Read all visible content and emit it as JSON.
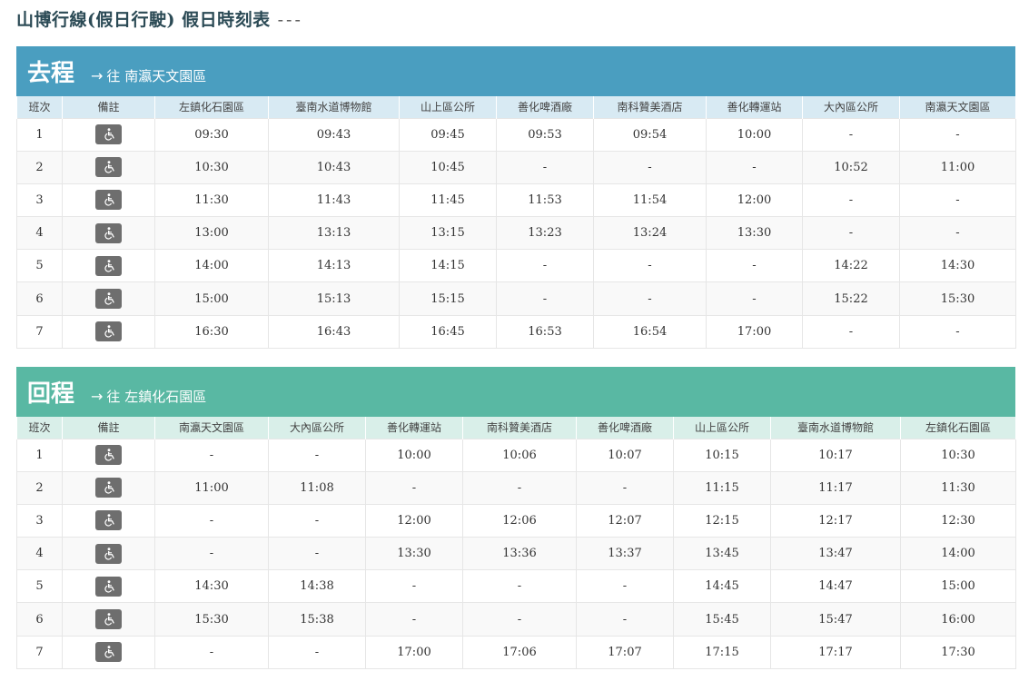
{
  "page": {
    "title": "山博行線(假日行駛) 假日時刻表",
    "dashes": "---"
  },
  "outbound": {
    "title": "去程",
    "arrow": "→",
    "dest": "往 南瀛天文園區",
    "headers": [
      "班次",
      "備註",
      "左鎮化石園區",
      "臺南水道博物館",
      "山上區公所",
      "善化啤酒廠",
      "南科贊美酒店",
      "善化轉運站",
      "大內區公所",
      "南瀛天文園區"
    ],
    "rows": [
      [
        "1",
        "09:30",
        "09:43",
        "09:45",
        "09:53",
        "09:54",
        "10:00",
        "-",
        "-"
      ],
      [
        "2",
        "10:30",
        "10:43",
        "10:45",
        "-",
        "-",
        "-",
        "10:52",
        "11:00"
      ],
      [
        "3",
        "11:30",
        "11:43",
        "11:45",
        "11:53",
        "11:54",
        "12:00",
        "-",
        "-"
      ],
      [
        "4",
        "13:00",
        "13:13",
        "13:15",
        "13:23",
        "13:24",
        "13:30",
        "-",
        "-"
      ],
      [
        "5",
        "14:00",
        "14:13",
        "14:15",
        "-",
        "-",
        "-",
        "14:22",
        "14:30"
      ],
      [
        "6",
        "15:00",
        "15:13",
        "15:15",
        "-",
        "-",
        "-",
        "15:22",
        "15:30"
      ],
      [
        "7",
        "16:30",
        "16:43",
        "16:45",
        "16:53",
        "16:54",
        "17:00",
        "-",
        "-"
      ]
    ]
  },
  "return": {
    "title": "回程",
    "arrow": "→",
    "dest": "往 左鎮化石園區",
    "headers": [
      "班次",
      "備註",
      "南瀛天文園區",
      "大內區公所",
      "善化轉運站",
      "南科贊美酒店",
      "善化啤酒廠",
      "山上區公所",
      "臺南水道博物館",
      "左鎮化石園區"
    ],
    "rows": [
      [
        "1",
        "-",
        "-",
        "10:00",
        "10:06",
        "10:07",
        "10:15",
        "10:17",
        "10:30"
      ],
      [
        "2",
        "11:00",
        "11:08",
        "-",
        "-",
        "-",
        "11:15",
        "11:17",
        "11:30"
      ],
      [
        "3",
        "-",
        "-",
        "12:00",
        "12:06",
        "12:07",
        "12:15",
        "12:17",
        "12:30"
      ],
      [
        "4",
        "-",
        "-",
        "13:30",
        "13:36",
        "13:37",
        "13:45",
        "13:47",
        "14:00"
      ],
      [
        "5",
        "14:30",
        "14:38",
        "-",
        "-",
        "-",
        "14:45",
        "14:47",
        "15:00"
      ],
      [
        "6",
        "15:30",
        "15:38",
        "-",
        "-",
        "-",
        "15:45",
        "15:47",
        "16:00"
      ],
      [
        "7",
        "-",
        "-",
        "17:00",
        "17:06",
        "17:07",
        "17:15",
        "17:17",
        "17:30"
      ]
    ]
  },
  "icons": {
    "note_icon": "wheelchair-accessible-icon"
  },
  "colors": {
    "outbound_header": "#4a9ec0",
    "return_header": "#59b8a3",
    "icon_bg": "#6e6e6e"
  }
}
